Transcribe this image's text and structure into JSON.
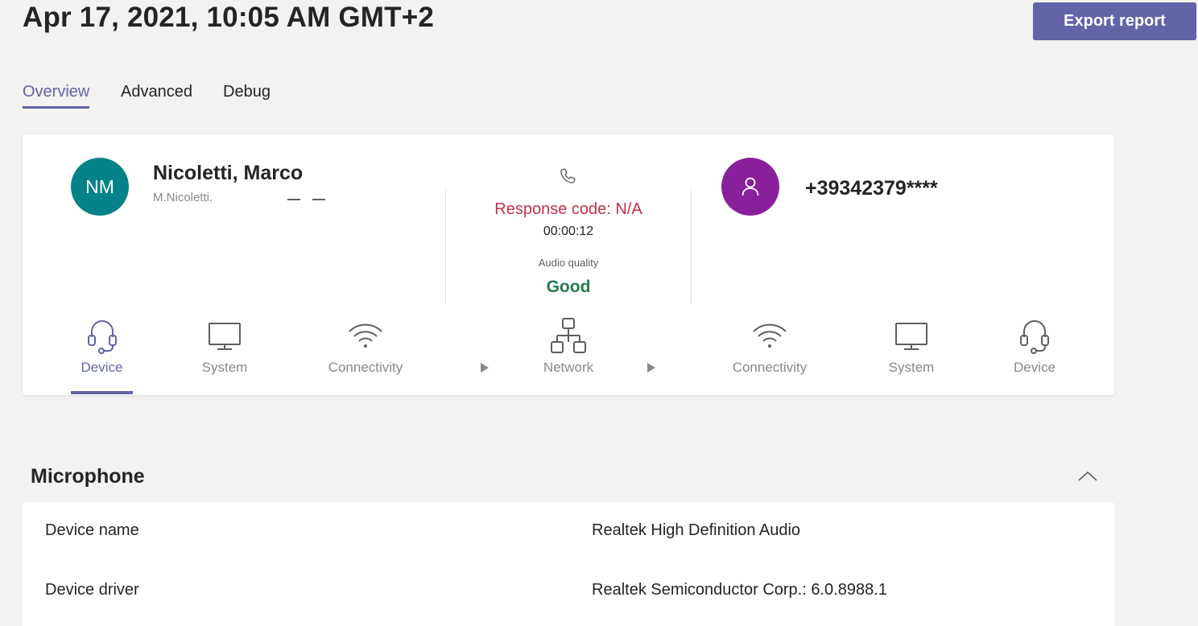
{
  "header": {
    "title": "Apr 17, 2021, 10:05 AM GMT+2",
    "export_label": "Export report"
  },
  "tabs": [
    {
      "label": "Overview",
      "active": true
    },
    {
      "label": "Advanced",
      "active": false
    },
    {
      "label": "Debug",
      "active": false
    }
  ],
  "call": {
    "caller": {
      "initials": "NM",
      "name": "Nicoletti, Marco",
      "sub": "M.Nicoletti.",
      "avatar_color": "#038387"
    },
    "center": {
      "icon": "phone-icon",
      "response_code": "Response code: N/A",
      "duration": "00:00:12",
      "audio_quality_label": "Audio quality",
      "audio_quality_value": "Good"
    },
    "callee": {
      "number": "+39342379****",
      "avatar_color": "#8a1f9c",
      "icon": "person-icon"
    }
  },
  "pipeline": [
    {
      "label": "Device",
      "icon": "headset-icon",
      "active": true
    },
    {
      "label": "System",
      "icon": "monitor-icon",
      "active": false
    },
    {
      "label": "Connectivity",
      "icon": "wifi-icon",
      "active": false
    },
    {
      "label": "Network",
      "icon": "network-icon",
      "active": false
    },
    {
      "label": "Connectivity",
      "icon": "wifi-icon",
      "active": false
    },
    {
      "label": "System",
      "icon": "monitor-icon",
      "active": false
    },
    {
      "label": "Device",
      "icon": "headset-icon",
      "active": false
    }
  ],
  "microphone": {
    "title": "Microphone",
    "rows": [
      {
        "label": "Device name",
        "value": "Realtek High Definition Audio"
      },
      {
        "label": "Device driver",
        "value": "Realtek Semiconductor Corp.: 6.0.8988.1"
      }
    ]
  },
  "colors": {
    "accent": "#6264a7",
    "error": "#c4314b",
    "good": "#237b4b"
  }
}
